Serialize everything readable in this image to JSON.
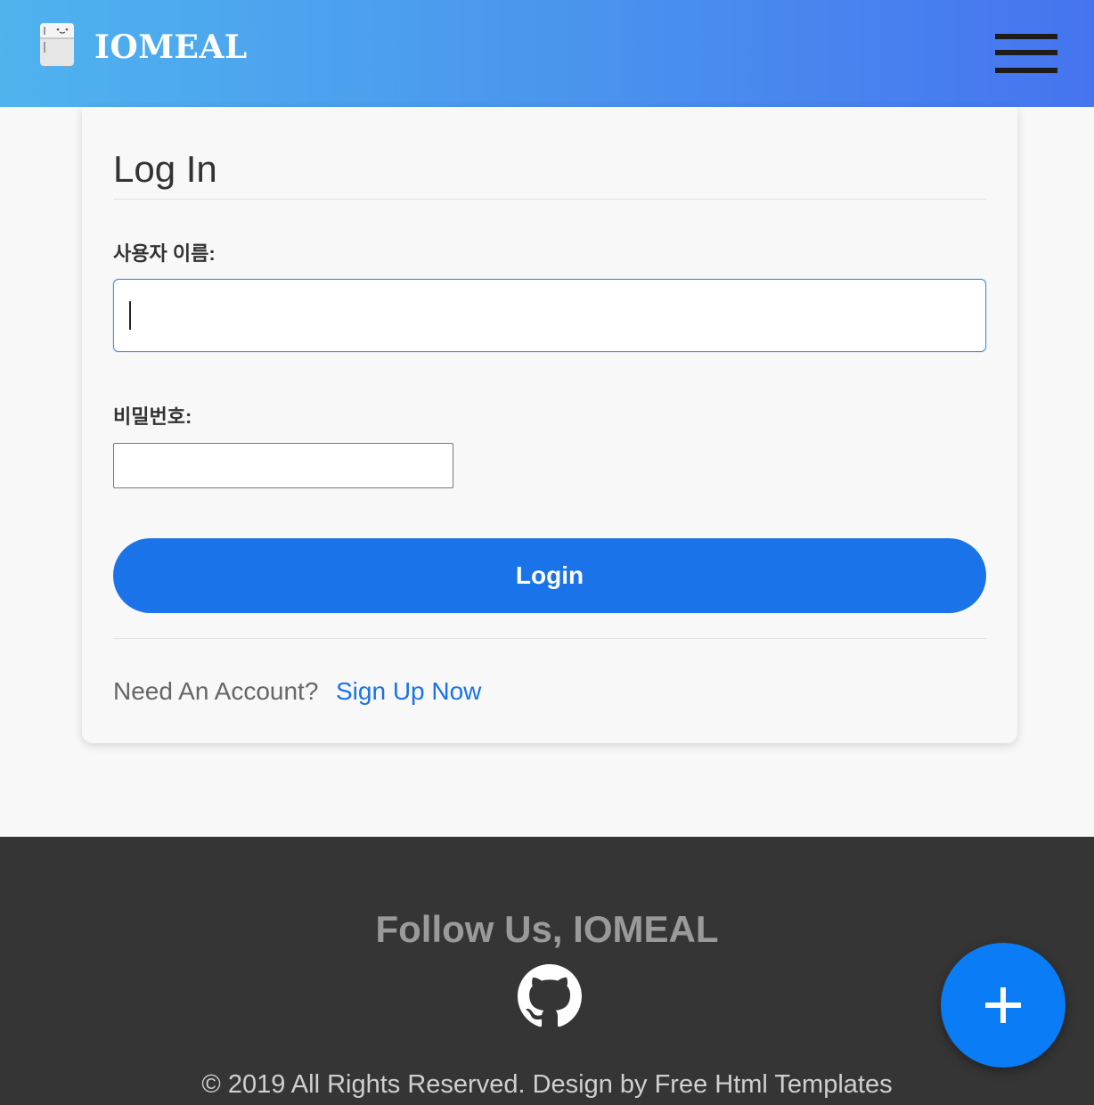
{
  "header": {
    "brand": "IOMEAL",
    "logo_icon": "fridge-icon",
    "menu_icon": "hamburger-menu-icon",
    "gradient_colors": [
      "#4fb3ee",
      "#4674ef"
    ]
  },
  "login_form": {
    "title": "Log In",
    "username_label": "사용자 이름:",
    "username_value": "",
    "password_label": "비밀번호:",
    "password_value": "",
    "submit_label": "Login",
    "need_account_text": "Need An Account?",
    "signup_link_label": "Sign Up Now",
    "accent_color": "#1a73e8"
  },
  "footer": {
    "title": "Follow Us, IOMEAL",
    "social_icon": "github-icon",
    "copyright": "© 2019 All Rights Reserved. Design by Free Html Templates"
  },
  "fab": {
    "icon": "plus-icon",
    "color": "#0a7cf5"
  }
}
